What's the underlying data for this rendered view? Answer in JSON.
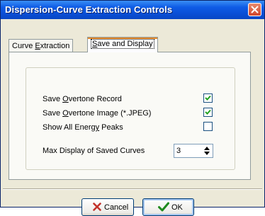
{
  "window": {
    "title": "Dispersion-Curve Extraction Controls"
  },
  "tabs": [
    {
      "pre": "Curve ",
      "u": "E",
      "post": "xtraction"
    },
    {
      "pre": "",
      "u": "S",
      "post": "ave and Display"
    }
  ],
  "options": [
    {
      "pre": "Save ",
      "u": "O",
      "post": "vertone Record",
      "checked": true
    },
    {
      "pre": "Save ",
      "u": "O",
      "post": "vertone Image (*.JPEG)",
      "checked": true
    },
    {
      "pre": "Show All Energ",
      "u": "y",
      "post": " Peaks",
      "checked": false
    }
  ],
  "max_display": {
    "label": "Max Display of Saved Curves",
    "value": "3"
  },
  "buttons": {
    "cancel": "Cancel",
    "ok": "OK"
  },
  "colors": {
    "title_bar": "#0a4fd6",
    "close": "#d0442a",
    "cancel_icon": "#c3332b",
    "ok_icon": "#1e8a1e"
  },
  "icons": {
    "close": "close-icon",
    "cancel": "x-icon",
    "ok": "checkmark-icon"
  }
}
